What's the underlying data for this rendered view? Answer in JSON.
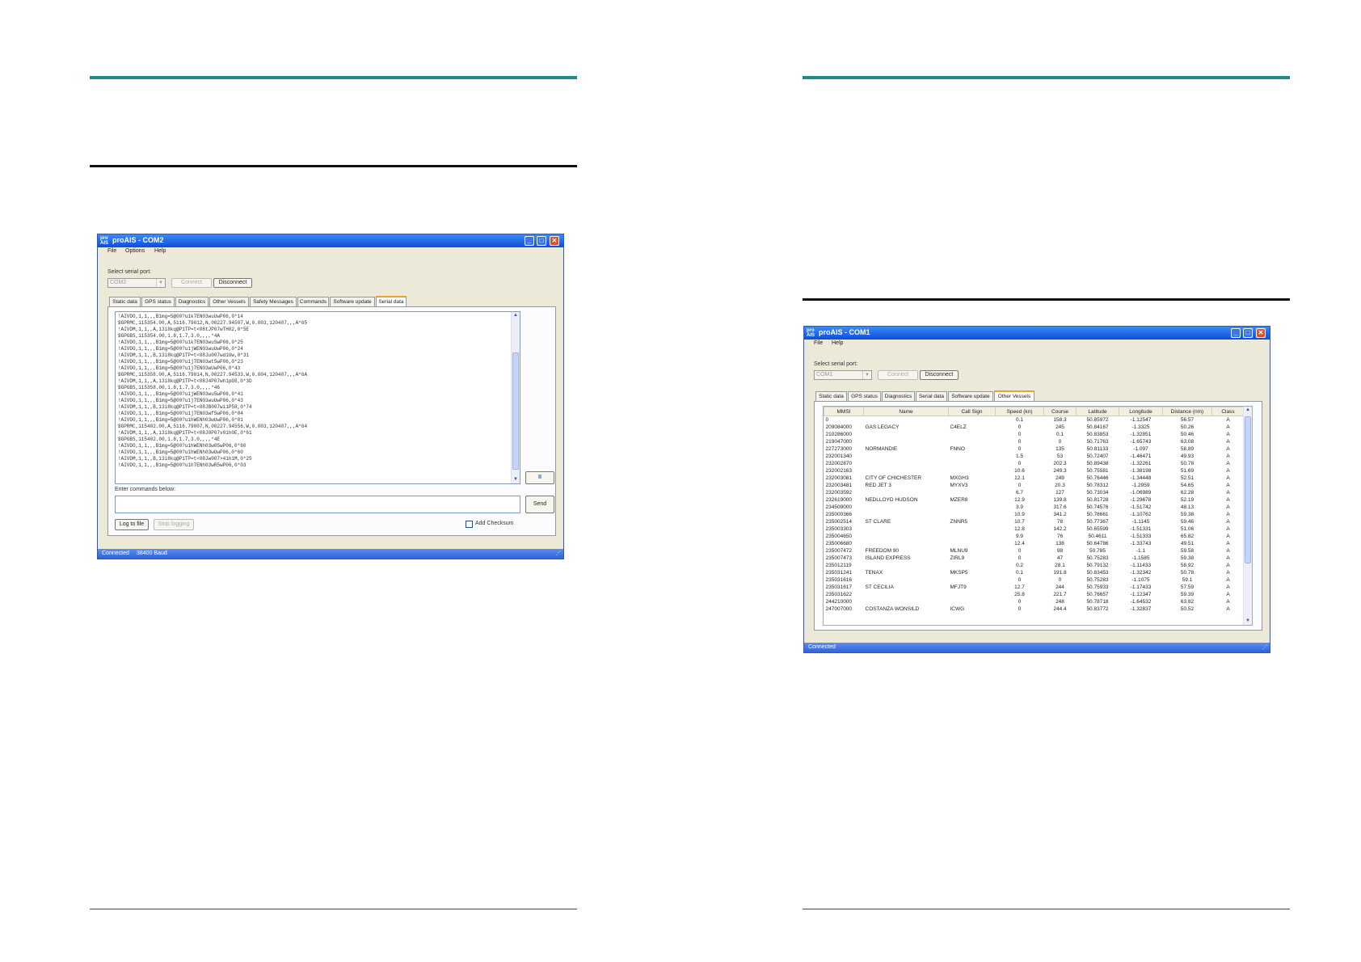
{
  "left_window": {
    "title": "proAIS - COM2",
    "menu": [
      "File",
      "Options",
      "Help"
    ],
    "serial_label": "Select serial port:",
    "port_value": "COM2",
    "connect_label": "Connect",
    "disconnect_label": "Disconnect",
    "tabs": [
      "Static data",
      "GPS status",
      "Diagnostics",
      "Other Vessels",
      "Safety Messages",
      "Commands",
      "Software update",
      "Serial data"
    ],
    "active_tab": "Serial data",
    "log_lines": [
      "!AIVDO,1,1,,,B1mg=5@00?u1k7EN03wuUwP06,0*14",
      "$GPRMC,115354.00,A,5116.79012,N,00227.94507,W,0.003,120407,,,A*65",
      "!AIVDM,1,1,,A,13i8kq@P1TP=t<08tJP07wTH02,0*5E",
      "$GPGBS,115354.00,1.8,1.7,3.0,,,,*4A",
      "!AIVDO,1,1,,,B1mg=5@00?u1k7EN03wuSwP06,0*25",
      "!AIVDO,1,1,,,B1mg=5@00?u1jWEN03wuUwP06,0*24",
      "!AIVDM,1,1,,B,13i8kq@P1TP=t<08Ju007wd1Uw,0*31",
      "!AIVDO,1,1,,,B1mg=5@00?u1j7EN03wt5wP06,0*23",
      "!AIVDO,1,1,,,B1mg=5@00?u1j7EN03wUwP06,0*43",
      "$GPRMC,115358.00,A,5116.79014,N,00227.94533,W,0.004,120407,,,A*6A",
      "!AIVDM,1,1,,A,13i8kq@P1TP=t<08J4P07wh1pG8,0*3D",
      "$GPGBS,115358.00,1.8,1.7,3.0,,,,*46",
      "!AIVDO,1,1,,,B1mg=5@00?u1jWEN03wu5wP06,0*41",
      "!AIVDO,1,1,,,B1mg=5@00?u1j7EN03wuUwP06,0*43",
      "!AIVDM,1,1,,B,13i8kq@P1TP=t<08JB007wi1P58,0*74",
      "!AIVDO,1,1,,,B1mg=5@00?u1j7EN03wf5wP06,0*04",
      "!AIVDO,1,1,,,B1mg=5@00?u1hWENh03wUwP06,0*01",
      "$GPRMC,115402.00,A,5116.79007,N,00227.94556,W,0.003,120407,,,A*64",
      "!AIVDM,1,1,,A,13i8kq@P1TP=t<08J0P07v01h0E,0*61",
      "$GPGBS,115402.00,1.8,1.7,3.0,,,,*4E",
      "!AIVDO,1,1,,,B1mg=5@00?u1hWENh03w05wP06,0*60",
      "!AIVDO,1,1,,,B1mg=5@00?u1hWENh03wUwP06,0*60",
      "!AIVDM,1,1,,B,13i8kq@P1TP=t<08Jw007>41h1M,0*25",
      "!AIVDO,1,1,,,B1mg=5@00?u1h7ENh03wR5wP06,0*03"
    ],
    "pause_label": "II",
    "commands_label": "Enter commands below:",
    "send_label": "Send",
    "log_to_file_label": "Log to file",
    "stop_logging_label": "Stop logging",
    "checksum_label": "Add Checksum",
    "status_connected": "Connected",
    "status_baud": "38400 Baud"
  },
  "right_window": {
    "title": "proAIS - COM1",
    "menu": [
      "File",
      "Help"
    ],
    "serial_label": "Select serial port:",
    "port_value": "COM1",
    "connect_label": "Connect",
    "disconnect_label": "Disconnect",
    "tabs": [
      "Static data",
      "GPS status",
      "Diagnostics",
      "Serial data",
      "Software update",
      "Other Vessels"
    ],
    "active_tab": "Other Vessels",
    "columns": [
      "MMSI",
      "Name",
      "Call Sign",
      "Speed (kn)",
      "Course",
      "Latitude",
      "Longitude",
      "Distance (nm)",
      "Class"
    ],
    "rows": [
      [
        "0",
        "",
        "",
        "0.1",
        "158.3",
        "50.85972",
        "-1.12547",
        "56.57",
        "A"
      ],
      [
        "209084000",
        "GAS LEGACY",
        "C4ELZ",
        "0",
        "245",
        "50.84167",
        "-1.3325",
        "50.26",
        "A"
      ],
      [
        "210286000",
        "",
        "",
        "0",
        "0.1",
        "50.83853",
        "-1.32851",
        "50.46",
        "A"
      ],
      [
        "219047000",
        "",
        "",
        "0",
        "0",
        "50.71763",
        "-1.65743",
        "63.08",
        "A"
      ],
      [
        "227273000",
        "NORMANDIE",
        "FNNO",
        "0",
        "135",
        "50.81133",
        "-1.097",
        "58.89",
        "A"
      ],
      [
        "232001340",
        "",
        "",
        "1.5",
        "53",
        "50.72407",
        "-1.46471",
        "49.93",
        "A"
      ],
      [
        "232002870",
        "",
        "",
        "0",
        "202.3",
        "50.89438",
        "-1.32261",
        "50.78",
        "A"
      ],
      [
        "232002163",
        "",
        "",
        "10.6",
        "249.3",
        "50.75581",
        "-1.38198",
        "51.69",
        "A"
      ],
      [
        "232003081",
        "CITY OF CHICHESTER",
        "MXGH3",
        "12.1",
        "249",
        "50.76446",
        "-1.34448",
        "52.51",
        "A"
      ],
      [
        "232003481",
        "RED JET 3",
        "MYXV3",
        "0",
        "20.3",
        "50.78312",
        "-1.2959",
        "54.65",
        "A"
      ],
      [
        "232003592",
        "",
        "",
        "6.7",
        "127",
        "50.73034",
        "-1.06989",
        "62.28",
        "A"
      ],
      [
        "232619000",
        "NEDLLOYD HUDSON",
        "MZER8",
        "12.9",
        "139.8",
        "50.81728",
        "-1.29678",
        "52.19",
        "A"
      ],
      [
        "234509000",
        "",
        "",
        "3.9",
        "317.6",
        "50.74576",
        "-1.51742",
        "48.13",
        "A"
      ],
      [
        "235000366",
        "",
        "",
        "10.9",
        "341.2",
        "50.78661",
        "-1.10762",
        "59.38",
        "A"
      ],
      [
        "235002514",
        "ST CLARE",
        "ZNNR5",
        "10.7",
        "78",
        "50.77367",
        "-1.1145",
        "59.46",
        "A"
      ],
      [
        "235003303",
        "",
        "",
        "12.8",
        "142.2",
        "50.65599",
        "-1.51331",
        "51.06",
        "A"
      ],
      [
        "235004650",
        "",
        "",
        "9.9",
        "76",
        "50.4611",
        "-1.51333",
        "65.82",
        "A"
      ],
      [
        "235006680",
        "",
        "",
        "12.4",
        "138",
        "50.64786",
        "-1.33743",
        "49.51",
        "A"
      ],
      [
        "235007472",
        "FREEDOM 90",
        "MLNU9",
        "0",
        "98",
        "50.785",
        "-1.1",
        "59.58",
        "A"
      ],
      [
        "235007473",
        "ISLAND EXPRESS",
        "ZIRL9",
        "0",
        "47",
        "50.75283",
        "-1.1585",
        "59.38",
        "A"
      ],
      [
        "235012119",
        "",
        "",
        "0.2",
        "28.1",
        "50.79132",
        "-1.11433",
        "58.92",
        "A"
      ],
      [
        "235031241",
        "TENAX",
        "MKSP5",
        "0.1",
        "191.8",
        "50.83453",
        "-1.32342",
        "50.78",
        "A"
      ],
      [
        "235031616",
        "",
        "",
        "0",
        "0",
        "50.75283",
        "-1.1075",
        "59.1",
        "A"
      ],
      [
        "235031617",
        "ST CECILIA",
        "MFJT9",
        "12.7",
        "244",
        "50.75933",
        "-1.17433",
        "57.59",
        "A"
      ],
      [
        "235031622",
        "",
        "",
        "25.8",
        "221.7",
        "50.76657",
        "-1.12347",
        "59.39",
        "A"
      ],
      [
        "244210000",
        "",
        "",
        "0",
        "248",
        "50.78718",
        "-1.64532",
        "63.82",
        "A"
      ],
      [
        "247007000",
        "COSTANZA WONSILD",
        "ICWG",
        "0",
        "244.4",
        "50.83772",
        "-1.32837",
        "50.52",
        "A"
      ]
    ],
    "status_connected": "Connected"
  }
}
